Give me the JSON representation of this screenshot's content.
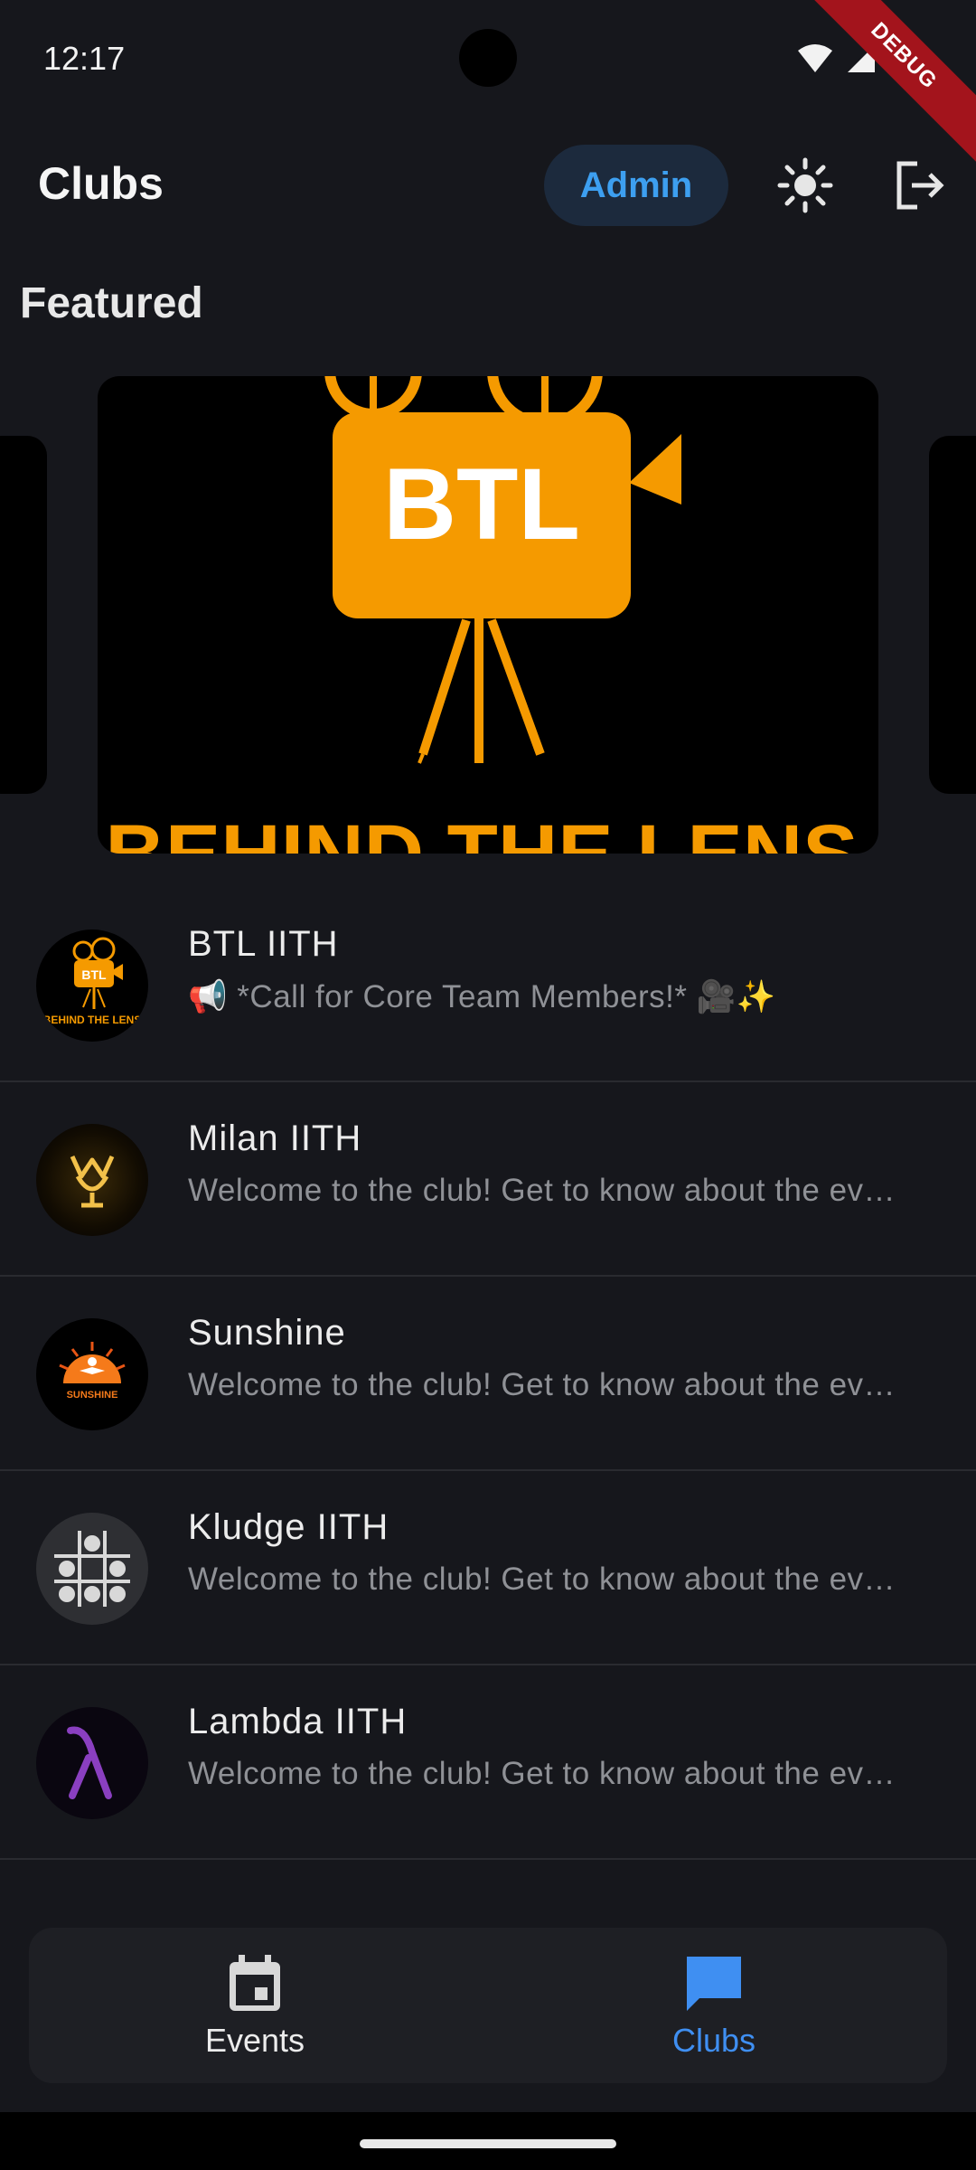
{
  "status_bar": {
    "time": "12:17",
    "debug_label": "DEBUG"
  },
  "app_bar": {
    "title": "Clubs",
    "admin_label": "Admin"
  },
  "featured": {
    "heading": "Featured",
    "card": {
      "logo_text": "BTL",
      "banner_text": "BEHIND THE LENS"
    }
  },
  "clubs": [
    {
      "name": "BTL IITH",
      "message": "📢 *Call for Core Team Members!* 🎥✨",
      "avatar": "btl-logo"
    },
    {
      "name": "Milan IITH",
      "message": "Welcome to the club! Get to know about the events here",
      "avatar": "milan-logo"
    },
    {
      "name": "Sunshine",
      "message": "Welcome to the club! Get to know about the events here",
      "avatar": "sunshine-logo"
    },
    {
      "name": "Kludge IITH",
      "message": "Welcome to the club! Get to know about the events here",
      "avatar": "kludge-logo"
    },
    {
      "name": "Lambda IITH",
      "message": "Welcome to the club! Get to know about the events here",
      "avatar": "lambda-logo"
    }
  ],
  "bottom_nav": {
    "items": [
      {
        "label": "Events",
        "icon": "calendar-icon",
        "active": false
      },
      {
        "label": "Clubs",
        "icon": "chat-icon",
        "active": true
      }
    ]
  },
  "colors": {
    "background": "#16171c",
    "accent": "#3f8ff2",
    "admin_chip_bg": "#1c2a3d",
    "btl_orange": "#f59a00"
  }
}
